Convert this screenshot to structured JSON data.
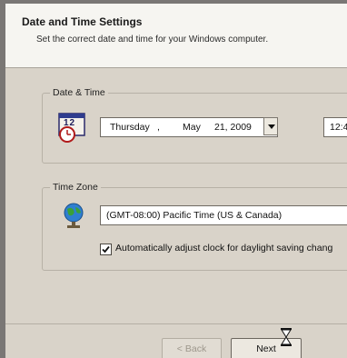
{
  "window": {
    "title": "Date and Time Settings",
    "subtitle": "Set the correct date and time for your Windows computer."
  },
  "date_time": {
    "group_label": "Date & Time",
    "calendar_icon_digits": "12",
    "weekday": "Thursday",
    "separator": ",",
    "month": "May",
    "day_year": "21, 2009",
    "time_partial": "12:4"
  },
  "time_zone": {
    "group_label": "Time Zone",
    "selected": "(GMT-08:00) Pacific Time (US & Canada)",
    "dst_checkbox_label": "Automatically adjust clock for daylight saving chang",
    "dst_checked": true
  },
  "buttons": {
    "back_label": "< Back",
    "next_label": "Next"
  }
}
